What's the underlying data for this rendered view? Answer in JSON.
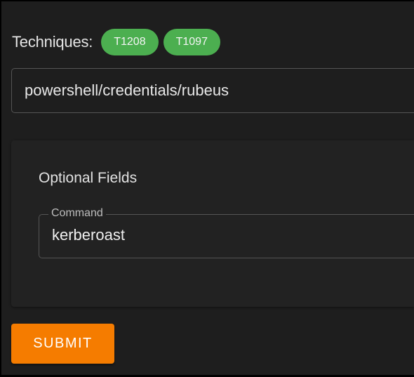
{
  "techniques": {
    "label": "Techniques:",
    "chips": [
      "T1208",
      "T1097"
    ],
    "chip_color": "#4caf50"
  },
  "module_input": {
    "value": "powershell/credentials/rubeus"
  },
  "optional_fields": {
    "title": "Optional Fields",
    "command": {
      "label": "Command",
      "value": "kerberoast"
    }
  },
  "submit": {
    "label": "SUBMIT",
    "color": "#f57c00"
  }
}
